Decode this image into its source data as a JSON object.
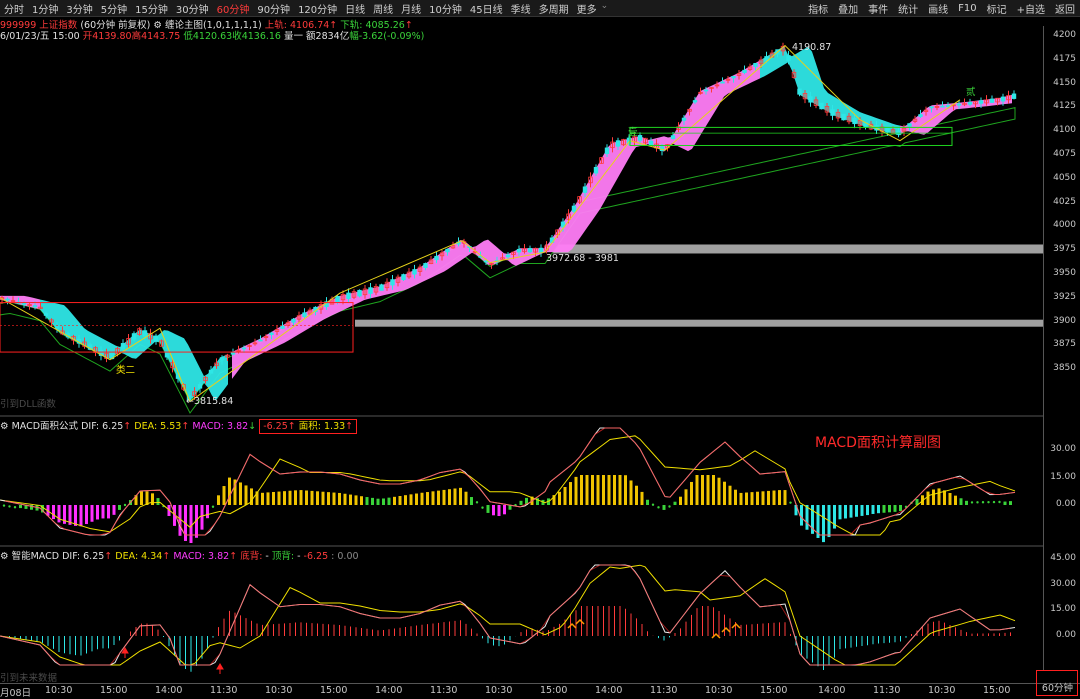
{
  "toolbar": {
    "periods": [
      "分时",
      "1分钟",
      "3分钟",
      "5分钟",
      "15分钟",
      "30分钟",
      "60分钟",
      "90分钟",
      "120分钟",
      "日线",
      "周线",
      "月线",
      "10分钟",
      "45日线",
      "季线",
      "多周期",
      "更多"
    ],
    "active_period": "60分钟",
    "right_items": [
      "指标",
      "叠加",
      "事件",
      "统计",
      "画线",
      "F10",
      "标记",
      "+自选",
      "返回"
    ]
  },
  "info": {
    "code": "999999",
    "name": "上证指数",
    "period_note": "(60分钟 前复权)",
    "indicator": "缠论主图(1,0,1,1,1,1)",
    "upper_label": "上轨: 4106.74",
    "lower_label": "下轨: 4085.26",
    "date": "6/01/23/五 15:00",
    "open": "开4139.80",
    "high": "高4143.75",
    "low": "低4120.63",
    "close": "收4136.16",
    "volume": "量一 额2834亿",
    "change": "幅-3.62(-0.09%)"
  },
  "main_chart": {
    "y_labels": [
      "4200",
      "4175",
      "4150",
      "4125",
      "4100",
      "4075",
      "4050",
      "4025",
      "4000",
      "3975",
      "3950",
      "3925",
      "3900",
      "3875",
      "3850"
    ],
    "annotations": [
      "4190.87",
      "3972.68 - 3981",
      "3815.84",
      "类二",
      "贰",
      "壹"
    ],
    "watermark": "引到DLL函数"
  },
  "macd_area": {
    "name": "MACD面积公式",
    "dif": "DIF: 6.25",
    "dea": "DEA: 5.53",
    "macd": "MACD: 3.82",
    "neg": "-6.25",
    "area": "面积: 1.33",
    "y_labels": [
      "30.00",
      "15.00",
      "0.00"
    ],
    "annotation": "MACD面积计算副图"
  },
  "smart_macd": {
    "name": "智能MACD",
    "dif": "DIF: 6.25",
    "dea": "DEA: 4.34",
    "macd": "MACD: 3.82",
    "bottom_div": "底背:",
    "top_div": "顶背:",
    "neg": "-6.25",
    "zero": "0.00",
    "y_labels": [
      "45.00",
      "30.00",
      "15.00",
      "0.00"
    ],
    "watermark": "引到未来数据"
  },
  "x_axis": {
    "labels": [
      "月08日",
      "10:30",
      "15:00",
      "14:00",
      "11:30",
      "10:30",
      "15:00",
      "14:00",
      "11:30",
      "10:30",
      "15:00",
      "14:00",
      "11:30",
      "10:30",
      "15:00",
      "14:00",
      "11:30",
      "10:30",
      "15:00"
    ],
    "period_badge": "60分钟"
  }
}
